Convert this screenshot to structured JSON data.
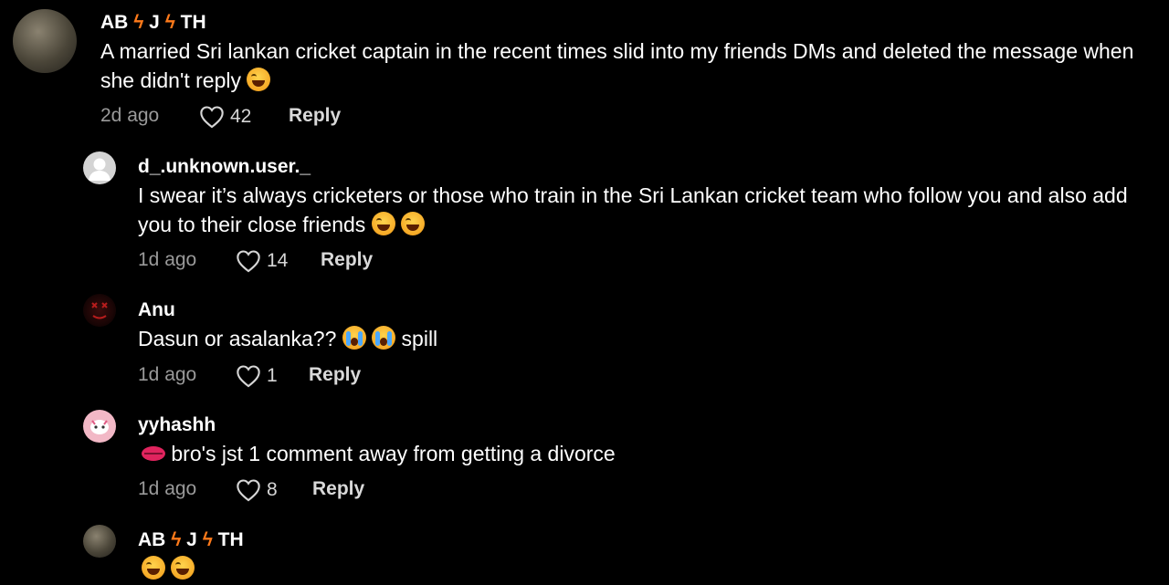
{
  "comments": [
    {
      "username_parts": [
        "AB",
        "J",
        "TH"
      ],
      "text": "A married Sri lankan cricket captain in the recent times slid into my friends DMs and deleted the message when she didn't reply",
      "emojis": [
        "laugh"
      ],
      "time": "2d ago",
      "likes": "42",
      "reply": "Reply"
    },
    {
      "username": "d_.unknown.user._",
      "text": "I swear it’s always cricketers or those who train in the Sri Lankan cricket team who follow you and also add you to their close friends",
      "emojis": [
        "laugh",
        "laugh"
      ],
      "time": "1d ago",
      "likes": "14",
      "reply": "Reply"
    },
    {
      "username": "Anu",
      "text_before": "Dasun or asalanka??",
      "emojis": [
        "cry",
        "cry"
      ],
      "text_after": "spill",
      "time": "1d ago",
      "likes": "1",
      "reply": "Reply"
    },
    {
      "username": "yyhashh",
      "emojis": [
        "lips"
      ],
      "text": "bro's jst 1 comment away from getting a divorce",
      "time": "1d ago",
      "likes": "8",
      "reply": "Reply"
    },
    {
      "username_parts": [
        "AB",
        "J",
        "TH"
      ],
      "emojis": [
        "laugh",
        "laugh"
      ]
    }
  ],
  "colors": {
    "background": "#000000",
    "bolt": "#ff7a1a",
    "meta": "#9a9a9a"
  },
  "icons": {
    "like": "heart-outline-icon",
    "bolt": "lightning-bolt-icon"
  }
}
